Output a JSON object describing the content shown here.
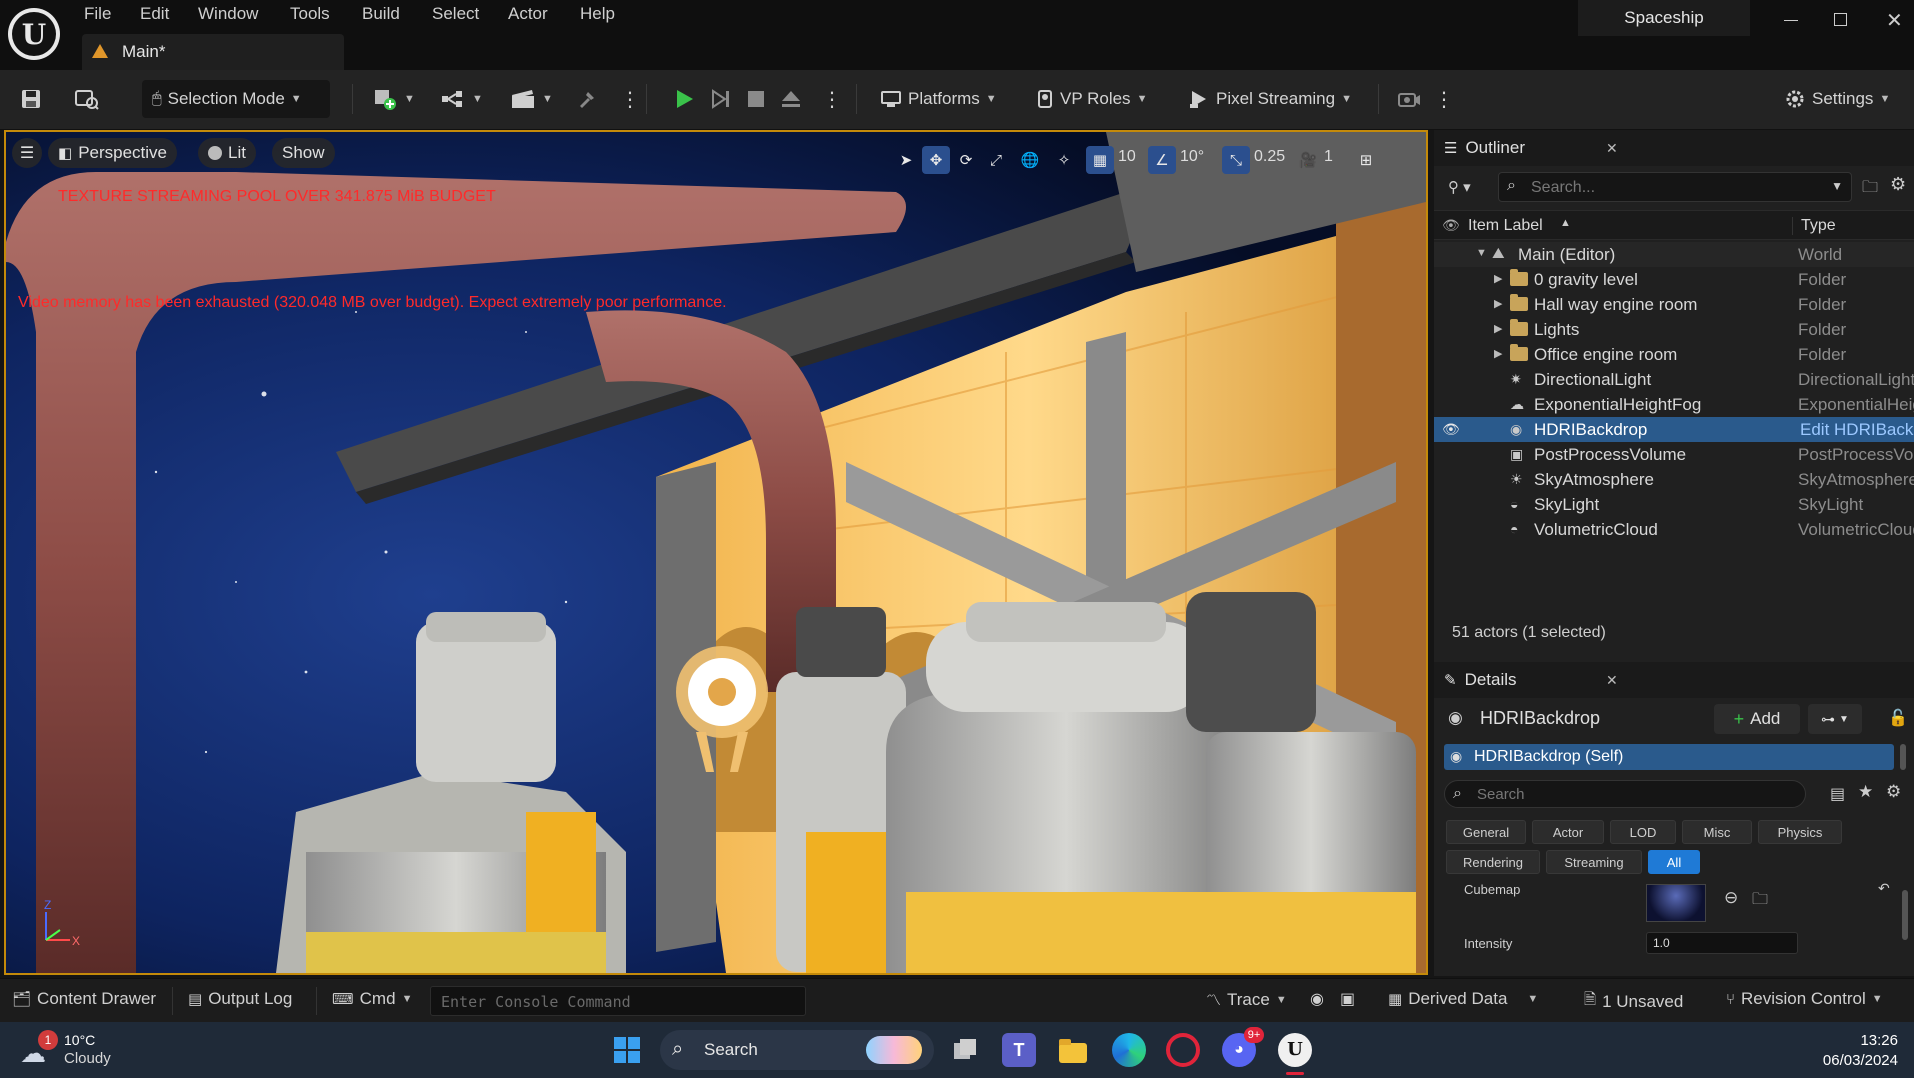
{
  "menu": [
    "File",
    "Edit",
    "Window",
    "Tools",
    "Build",
    "Select",
    "Actor",
    "Help"
  ],
  "project_title": "Spaceship",
  "doc_tab": "Main*",
  "toolbar": {
    "selection_mode": "Selection Mode",
    "platforms": "Platforms",
    "vp_roles": "VP Roles",
    "pixel_streaming": "Pixel Streaming",
    "settings": "Settings"
  },
  "viewport": {
    "perspective": "Perspective",
    "lit": "Lit",
    "show": "Show",
    "grid_snap": "10",
    "rotation_snap": "10°",
    "scale_snap": "0.25",
    "camera_speed": "1",
    "warning_texture": "TEXTURE STREAMING POOL OVER 341.875 MiB BUDGET",
    "warning_memory": "Video memory has been exhausted (320.048 MB over budget). Expect extremely poor performance.",
    "axis_z": "Z",
    "axis_x": "X"
  },
  "outliner": {
    "title": "Outliner",
    "search_placeholder": "Search...",
    "col_label": "Item Label",
    "col_type": "Type",
    "rows": [
      {
        "label": "Main (Editor)",
        "type": "World"
      },
      {
        "label": "0 gravity level",
        "type": "Folder"
      },
      {
        "label": "Hall way engine room",
        "type": "Folder"
      },
      {
        "label": "Lights",
        "type": "Folder"
      },
      {
        "label": "Office engine room",
        "type": "Folder"
      },
      {
        "label": "DirectionalLight",
        "type": "DirectionalLight"
      },
      {
        "label": "ExponentialHeightFog",
        "type": "ExponentialHeightFog"
      },
      {
        "label": "HDRIBackdrop",
        "type": "Edit HDRIBackdrop"
      },
      {
        "label": "PostProcessVolume",
        "type": "PostProcessVolume"
      },
      {
        "label": "SkyAtmosphere",
        "type": "SkyAtmosphere"
      },
      {
        "label": "SkyLight",
        "type": "SkyLight"
      },
      {
        "label": "VolumetricCloud",
        "type": "VolumetricCloud"
      }
    ],
    "footer": "51 actors (1 selected)"
  },
  "details": {
    "title": "Details",
    "actor_name": "HDRIBackdrop",
    "add_label": "Add",
    "component": "HDRIBackdrop (Self)",
    "search_placeholder": "Search",
    "filters_row1": [
      "General",
      "Actor",
      "LOD",
      "Misc",
      "Physics"
    ],
    "filters_row2": [
      "Rendering",
      "Streaming",
      "All"
    ],
    "prop_cubemap": "Cubemap",
    "prop_intensity": "Intensity",
    "intensity_value": "1.0"
  },
  "statusbar": {
    "content_drawer": "Content Drawer",
    "output_log": "Output Log",
    "cmd": "Cmd",
    "console_placeholder": "Enter Console Command",
    "trace": "Trace",
    "derived_data": "Derived Data",
    "unsaved": "1 Unsaved",
    "revision_control": "Revision Control"
  },
  "taskbar": {
    "weather_temp": "10°C",
    "weather_desc": "Cloudy",
    "weather_badge": "1",
    "search": "Search",
    "discord_badge": "9+",
    "time": "13:26",
    "date": "06/03/2024"
  },
  "colors": {
    "accent": "#c48a0a",
    "selection": "#2a5a8c",
    "play": "#3ac24a",
    "warning": "#ff2a2a"
  }
}
